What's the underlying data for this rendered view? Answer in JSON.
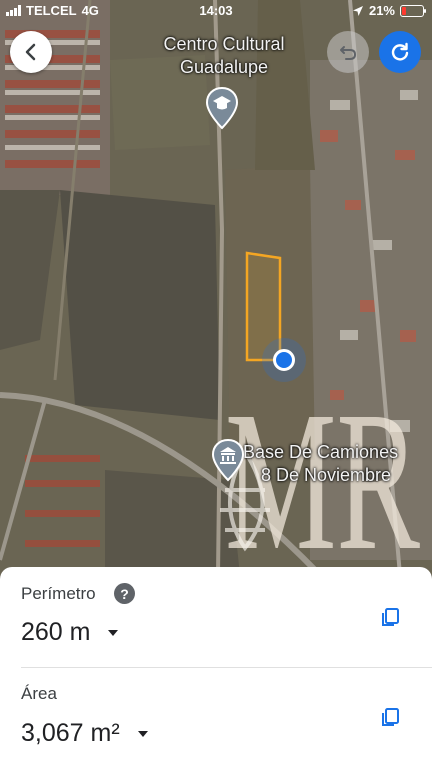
{
  "status_bar": {
    "carrier": "TELCEL",
    "network": "4G",
    "time": "14:03",
    "battery": "21%"
  },
  "map": {
    "places": [
      {
        "name_line1": "Centro Cultural",
        "name_line2": "Guadalupe",
        "icon": "graduation-cap-icon"
      },
      {
        "name_line1": "Base De Camiones",
        "name_line2": "8 De Noviembre",
        "icon": "bus-station-icon"
      }
    ],
    "watermark": "MR",
    "colors": {
      "measure_outline": "#f4a623",
      "location_dot": "#1a73e8"
    }
  },
  "controls": {
    "back": "back-arrow-icon",
    "undo": "undo-icon",
    "redo": "redo-icon"
  },
  "measurement": {
    "perimeter_label": "Perímetro",
    "perimeter_value": "260 m",
    "area_label": "Área",
    "area_value": "3,067 m²",
    "help_glyph": "?"
  }
}
